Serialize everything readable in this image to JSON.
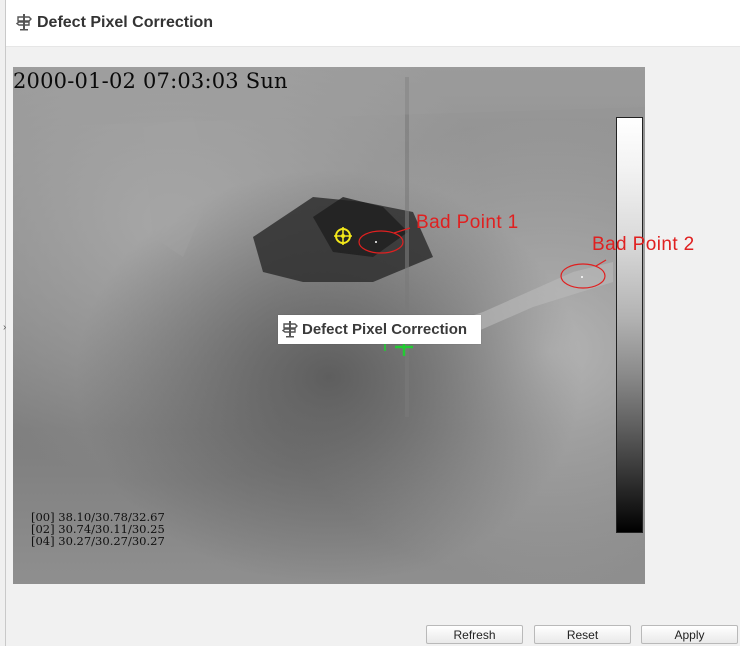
{
  "header": {
    "title": "Defect Pixel Correction",
    "icon": "sign-post-icon"
  },
  "video": {
    "timestamp": "2000-01-02 07:03:03 Sun",
    "readings": [
      "[00] 38.10/30.78/32.67",
      "[02] 30.74/30.11/30.25",
      "[04] 30.27/30.27/30.27"
    ]
  },
  "annotations": {
    "point1": "Bad Point 1",
    "point2": "Bad Point 2"
  },
  "floating_label": {
    "text": "Defect Pixel Correction",
    "icon": "sign-post-icon"
  },
  "buttons": {
    "refresh": "Refresh",
    "reset": "Reset",
    "apply": "Apply"
  },
  "colors": {
    "annotation": "#e02020",
    "target_marker": "#f3e81a",
    "cross_marker": "#22cc33"
  }
}
